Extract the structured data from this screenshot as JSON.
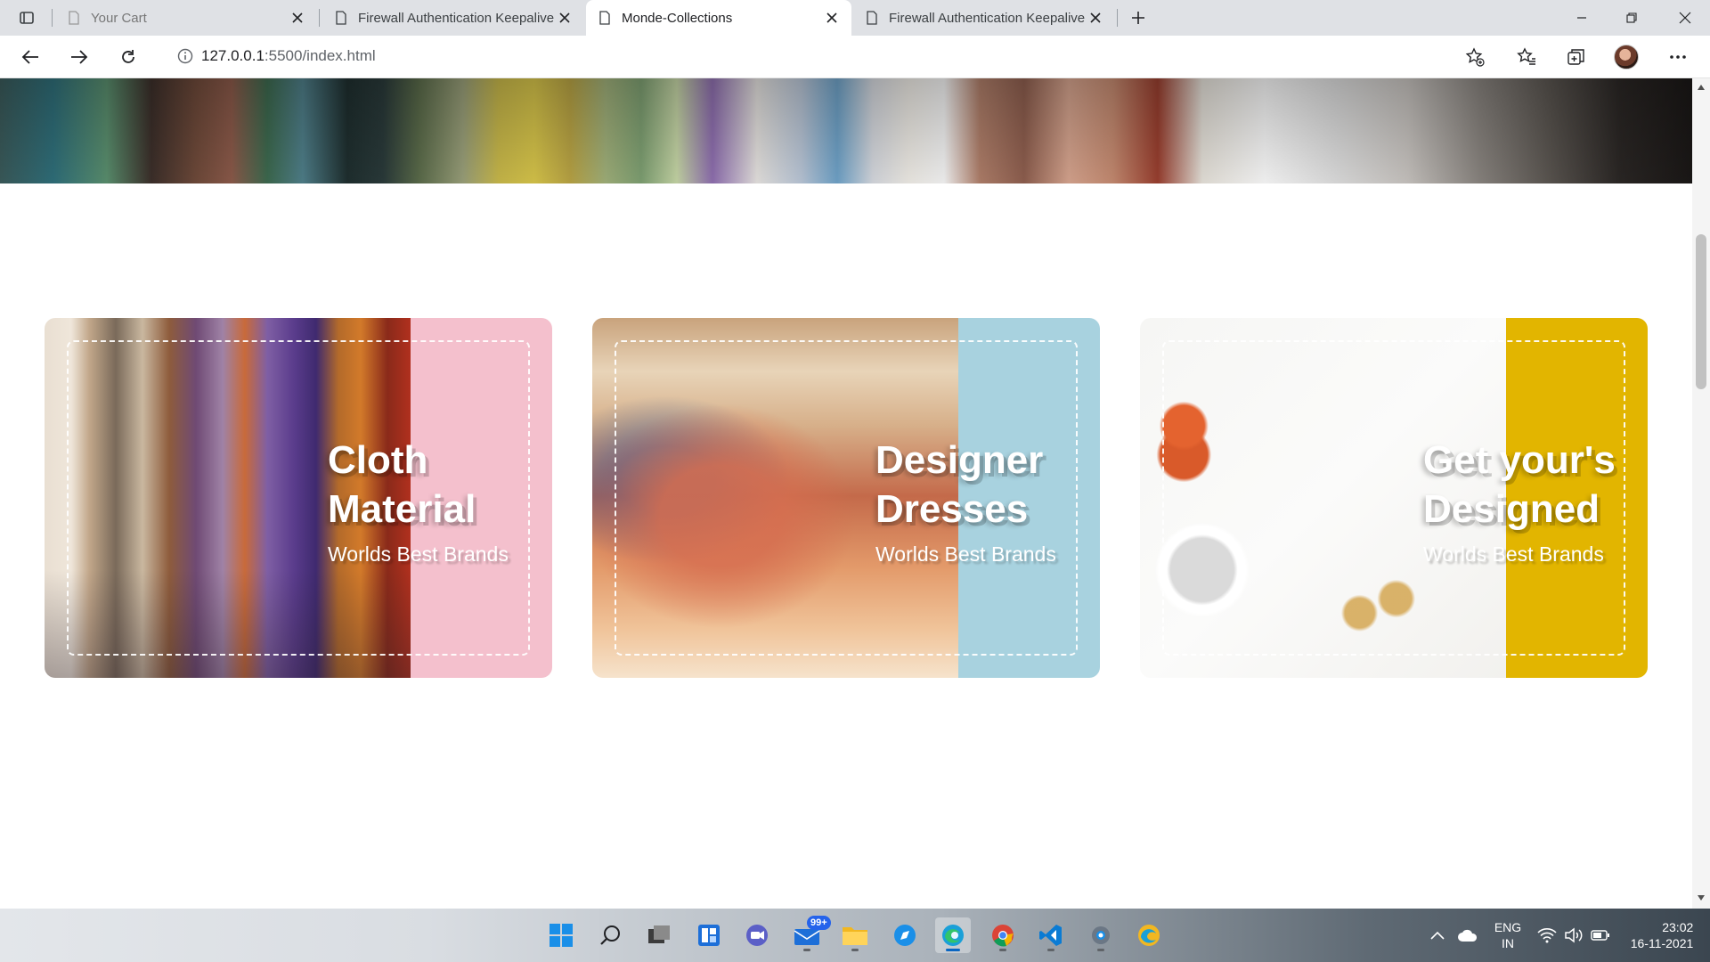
{
  "browser": {
    "tabs": [
      {
        "title": "Your Cart",
        "state": "inactive-dim"
      },
      {
        "title": "Firewall Authentication Keepalive",
        "state": "inactive"
      },
      {
        "title": "Monde-Collections",
        "state": "active"
      },
      {
        "title": "Firewall Authentication Keepalive",
        "state": "inactive"
      }
    ],
    "url": {
      "host": "127.0.0.1",
      "path": ":5500/index.html"
    }
  },
  "cards": [
    {
      "title_line1": "Cloth",
      "title_line2": "Material",
      "subtitle": "Worlds Best Brands",
      "panel_color": "#f4c0cd"
    },
    {
      "title_line1": "Designer",
      "title_line2": "Dresses",
      "subtitle": "Worlds Best Brands",
      "panel_color": "#a8d2df"
    },
    {
      "title_line1": "Get your's",
      "title_line2": "Designed",
      "subtitle": "Worlds Best Brands",
      "panel_color": "#e2b500"
    }
  ],
  "taskbar": {
    "apps": [
      "windows-start",
      "search",
      "task-view",
      "widgets",
      "teams-meet",
      "mail",
      "file-explorer",
      "safari",
      "edge",
      "chrome",
      "vscode",
      "settings",
      "edge-canary"
    ],
    "mail_badge": "99+",
    "language": {
      "line1": "ENG",
      "line2": "IN"
    },
    "clock": {
      "time": "23:02",
      "date": "16-11-2021"
    }
  }
}
